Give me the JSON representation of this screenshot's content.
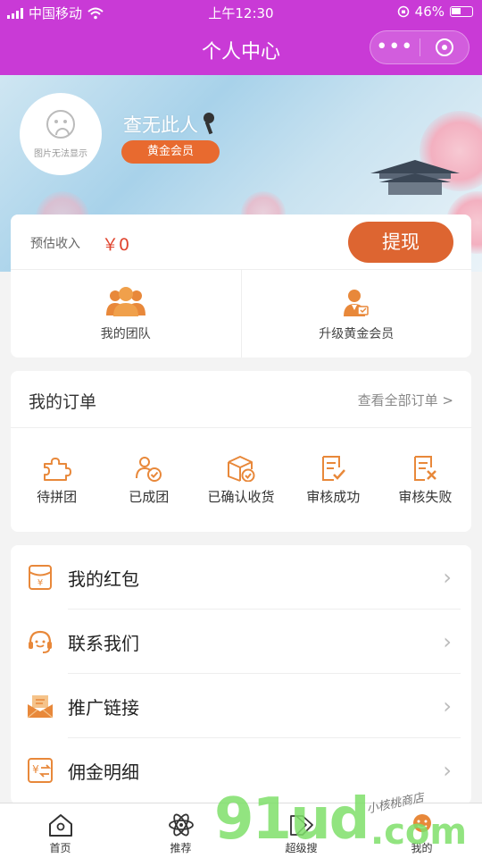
{
  "status_bar": {
    "carrier": "中国移动",
    "time": "上午12:30",
    "battery": "46%"
  },
  "nav": {
    "title": "个人中心",
    "more": "•••"
  },
  "profile": {
    "avatar_text": "图片无法显示",
    "nickname": "查无此人",
    "member_badge": "黄金会员"
  },
  "earnings": {
    "label": "预估收入",
    "amount": "￥0",
    "withdraw": "提现"
  },
  "team_links": {
    "my_team": "我的团队",
    "upgrade": "升级黄金会员"
  },
  "orders": {
    "title": "我的订单",
    "view_all": "查看全部订单 >",
    "items": [
      "待拼团",
      "已成团",
      "已确认收货",
      "审核成功",
      "审核失败"
    ]
  },
  "menu": {
    "items": [
      "我的红包",
      "联系我们",
      "推广链接",
      "佣金明细"
    ]
  },
  "tabs": [
    "首页",
    "推荐",
    "超级搜",
    "我的"
  ],
  "watermark": {
    "brand": "91ud",
    "domain": ".com",
    "tagline": "小核桃商店"
  },
  "colors": {
    "nav": "#c93ad6",
    "accent": "#dd6531",
    "amount": "#e0452f",
    "icon": "#e8883a"
  }
}
